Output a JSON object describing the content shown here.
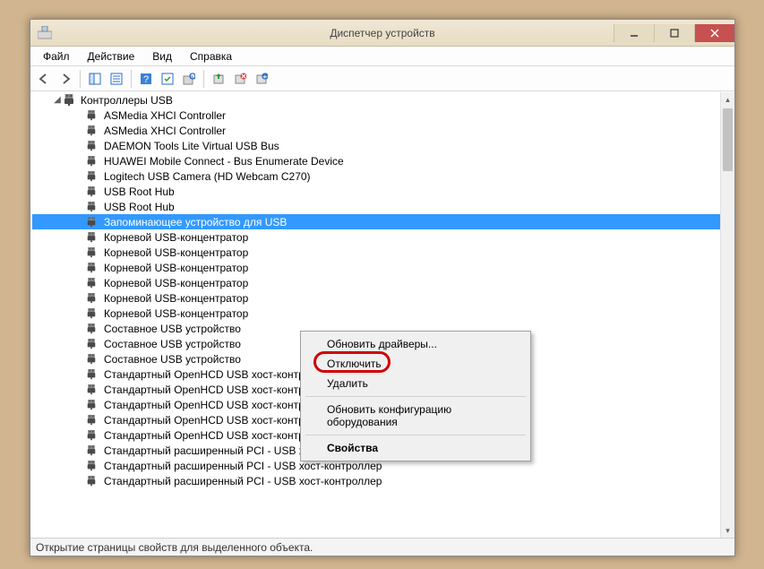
{
  "window": {
    "title": "Диспетчер устройств"
  },
  "menu": {
    "file": "Файл",
    "action": "Действие",
    "view": "Вид",
    "help": "Справка"
  },
  "tree": {
    "category": "Контроллеры USB",
    "items": [
      "ASMedia XHCI Controller",
      "ASMedia XHCI Controller",
      "DAEMON Tools Lite Virtual USB Bus",
      "HUAWEI Mobile Connect - Bus Enumerate Device",
      "Logitech USB Camera (HD Webcam C270)",
      "USB Root Hub",
      "USB Root Hub",
      "Запоминающее устройство для USB",
      "Корневой USB-концентратор",
      "Корневой USB-концентратор",
      "Корневой USB-концентратор",
      "Корневой USB-концентратор",
      "Корневой USB-концентратор",
      "Корневой USB-концентратор",
      "Составное USB устройство",
      "Составное USB устройство",
      "Составное USB устройство",
      "Стандартный OpenHCD USB хост-контроллер",
      "Стандартный OpenHCD USB хост-контроллер",
      "Стандартный OpenHCD USB хост-контроллер",
      "Стандартный OpenHCD USB хост-контроллер",
      "Стандартный OpenHCD USB хост-контроллер",
      "Стандартный расширенный PCI - USB хост-контроллер",
      "Стандартный расширенный PCI - USB хост-контроллер",
      "Стандартный расширенный PCI - USB хост-контроллер"
    ],
    "selected_index": 7
  },
  "context_menu": {
    "update_drivers": "Обновить драйверы...",
    "disable": "Отключить",
    "delete": "Удалить",
    "refresh_config": "Обновить конфигурацию оборудования",
    "properties": "Свойства"
  },
  "status": "Открытие страницы свойств для выделенного объекта."
}
